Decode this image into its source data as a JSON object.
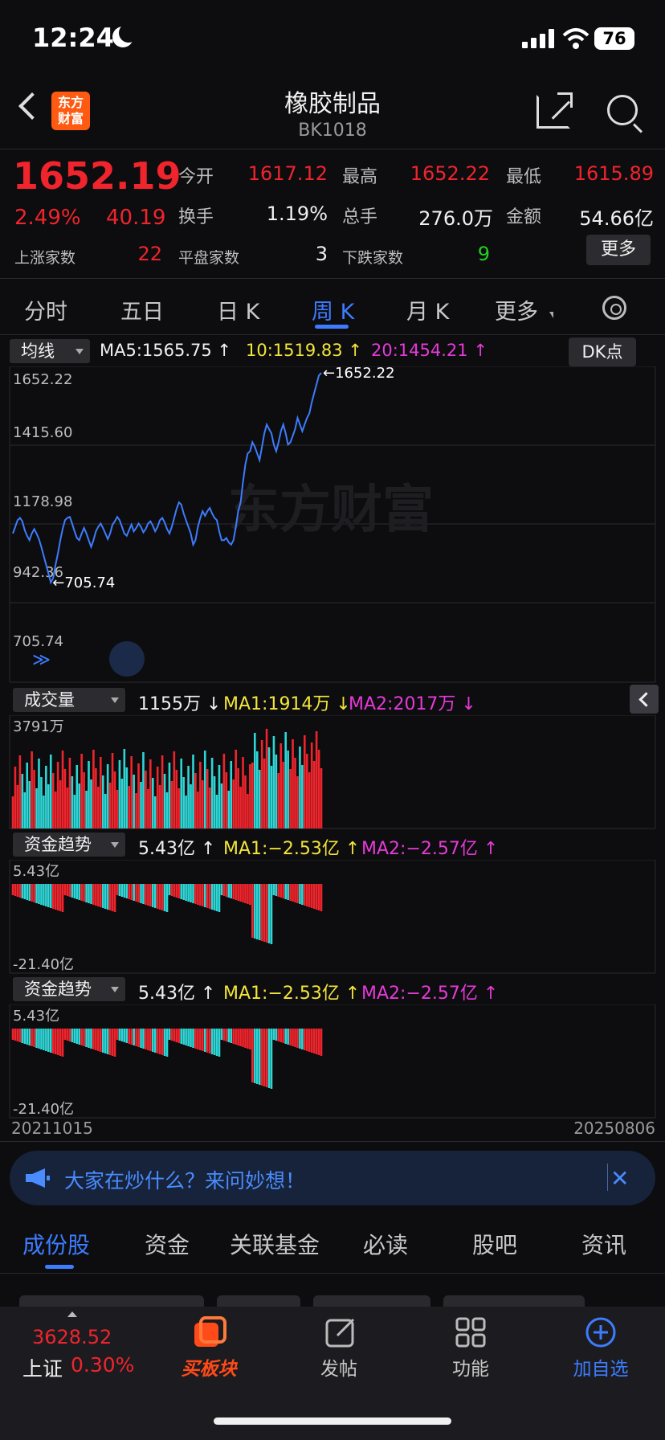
{
  "status": {
    "time": "12:24",
    "battery": "76"
  },
  "header": {
    "logo_text": "东方\n财富",
    "title": "橡胶制品",
    "code": "BK1018"
  },
  "quote": {
    "last_price": "1652.19",
    "change_pct": "2.49%",
    "change": "40.19",
    "open_label": "今开",
    "open": "1617.12",
    "high_label": "最高",
    "high": "1652.22",
    "low_label": "最低",
    "low": "1615.89",
    "turnover_label": "换手",
    "turnover": "1.19%",
    "volume_label": "总手",
    "volume": "276.0万",
    "amount_label": "金额",
    "amount": "54.66亿",
    "up_label": "上涨家数",
    "up_count": "22",
    "flat_label": "平盘家数",
    "flat_count": "3",
    "down_label": "下跌家数",
    "down_count": "9",
    "more_label": "更多"
  },
  "tabs": [
    "分时",
    "五日",
    "日 K",
    "周 K",
    "月 K",
    "更多"
  ],
  "active_tab": "周 K",
  "main_chart": {
    "selector": "均线",
    "ma5": "MA5:1565.75 ↑",
    "ma10": "10:1519.83 ↑",
    "ma20": "20:1454.21 ↑",
    "dk_label": "DK点",
    "y_ticks": [
      "1652.22",
      "1415.60",
      "1178.98",
      "942.36",
      "705.74"
    ],
    "max_label": "←1652.22",
    "min_label": "←705.74",
    "watermark": "东方财富"
  },
  "volume_panel": {
    "selector": "成交量",
    "value": "1155万 ↓",
    "ma1": "MA1:1914万 ↓",
    "ma2": "MA2:2017万 ↓",
    "top_label": "3791万"
  },
  "fund_panel_1": {
    "selector": "资金趋势",
    "value": "5.43亿 ↑",
    "ma1": "MA1:−2.53亿 ↑",
    "ma2": "MA2:−2.57亿 ↑",
    "top_label": "5.43亿",
    "bottom_label": "-21.40亿"
  },
  "fund_panel_2": {
    "selector": "资金趋势",
    "value": "5.43亿 ↑",
    "ma1": "MA1:−2.53亿 ↑",
    "ma2": "MA2:−2.57亿 ↑",
    "top_label": "5.43亿",
    "bottom_label": "-21.40亿"
  },
  "date_range": {
    "start": "20211015",
    "end": "20250806"
  },
  "banner": {
    "text": "大家在炒什么？来问妙想！"
  },
  "bottom_tabs": [
    "成份股",
    "资金",
    "关联基金",
    "必读",
    "股吧",
    "资讯"
  ],
  "bottom_nav": {
    "index_value": "3628.52",
    "index_name": "上证",
    "index_change": "0.30%",
    "items": [
      "买板块",
      "发帖",
      "功能",
      "加自选"
    ]
  },
  "chart_data": {
    "type": "line",
    "title": "",
    "xlabel": "",
    "ylabel": "",
    "x_range": [
      "20211015",
      "20250806"
    ],
    "ylim": [
      705.74,
      1652.22
    ],
    "series": [
      {
        "values": [
          930,
          960,
          990,
          1000,
          985,
          945,
          920,
          900,
          930,
          950,
          930,
          905,
          870,
          830,
          790,
          750,
          710,
          730,
          790,
          840,
          900,
          950,
          990,
          1000,
          1005,
          975,
          940,
          910,
          900,
          930,
          955,
          930,
          900,
          870,
          900,
          940,
          960,
          975,
          955,
          930,
          905,
          930,
          970,
          985,
          1005,
          990,
          960,
          930,
          920,
          945,
          970,
          940,
          955,
          975,
          960,
          935,
          950,
          975,
          985,
          965,
          940,
          960,
          990,
          1000,
          980,
          950,
          930,
          960,
          1000,
          1040,
          1070,
          1060,
          1020,
          990,
          960,
          930,
          880,
          900,
          960,
          1000,
          1030,
          1010,
          1030,
          1045,
          1020,
          1000,
          990,
          940,
          900,
          900,
          910,
          890,
          880,
          900,
          960,
          1030,
          1070,
          1160,
          1240,
          1290,
          1300,
          1340,
          1320,
          1290,
          1260,
          1320,
          1380,
          1420,
          1400,
          1380,
          1330,
          1300,
          1340,
          1390,
          1420,
          1380,
          1330,
          1340,
          1370,
          1400,
          1450,
          1420,
          1390,
          1420,
          1450,
          1470,
          1520,
          1560,
          1600,
          1640,
          1652.19
        ]
      }
    ]
  }
}
